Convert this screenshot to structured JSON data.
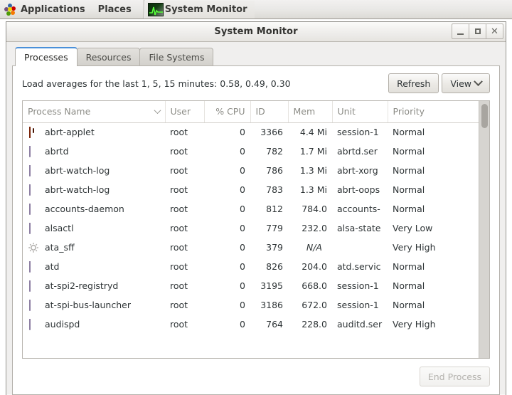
{
  "panel": {
    "applications_label": "Applications",
    "places_label": "Places",
    "apps_icon": "fedora-pinwheel-icon",
    "task": {
      "label": "System Monitor",
      "icon": "system-monitor-waveform-icon"
    }
  },
  "window": {
    "title": "System Monitor",
    "controls": {
      "minimize": "minimize-icon",
      "maximize": "maximize-icon",
      "close": "close-icon"
    }
  },
  "tabs": [
    {
      "label": "Processes",
      "active": true
    },
    {
      "label": "Resources",
      "active": false
    },
    {
      "label": "File Systems",
      "active": false
    }
  ],
  "toolbar": {
    "load_averages": "Load averages for the last 1, 5, 15 minutes: 0.58, 0.49, 0.30",
    "refresh_label": "Refresh",
    "view_label": "View"
  },
  "table": {
    "columns": [
      {
        "key": "name",
        "label": "Process Name",
        "align": "left",
        "sorted": true
      },
      {
        "key": "user",
        "label": "User",
        "align": "left"
      },
      {
        "key": "cpu",
        "label": "% CPU",
        "align": "right"
      },
      {
        "key": "id",
        "label": "ID",
        "align": "right"
      },
      {
        "key": "mem",
        "label": "Mem",
        "align": "right"
      },
      {
        "key": "unit",
        "label": "Unit",
        "align": "left"
      },
      {
        "key": "priority",
        "label": "Priority",
        "align": "left"
      }
    ],
    "rows": [
      {
        "icon": "abrt-applet-icon",
        "name": "abrt-applet",
        "user": "root",
        "cpu": "0",
        "id": "3366",
        "mem": "4.4 Mi",
        "unit": "session-1",
        "priority": "Normal"
      },
      {
        "icon": "binary-diamond-icon",
        "name": "abrtd",
        "user": "root",
        "cpu": "0",
        "id": "782",
        "mem": "1.7 Mi",
        "unit": "abrtd.ser",
        "priority": "Normal"
      },
      {
        "icon": "binary-diamond-icon",
        "name": "abrt-watch-log",
        "user": "root",
        "cpu": "0",
        "id": "786",
        "mem": "1.3 Mi",
        "unit": "abrt-xorg",
        "priority": "Normal"
      },
      {
        "icon": "binary-diamond-icon",
        "name": "abrt-watch-log",
        "user": "root",
        "cpu": "0",
        "id": "783",
        "mem": "1.3 Mi",
        "unit": "abrt-oops",
        "priority": "Normal"
      },
      {
        "icon": "binary-diamond-icon",
        "name": "accounts-daemon",
        "user": "root",
        "cpu": "0",
        "id": "812",
        "mem": "784.0",
        "unit": "accounts-",
        "priority": "Normal"
      },
      {
        "icon": "binary-diamond-icon",
        "name": "alsactl",
        "user": "root",
        "cpu": "0",
        "id": "779",
        "mem": "232.0",
        "unit": "alsa-state",
        "priority": "Very Low"
      },
      {
        "icon": "kernel-gear-icon",
        "name": "ata_sff",
        "user": "root",
        "cpu": "0",
        "id": "379",
        "mem": "N/A",
        "mem_na": true,
        "unit": "",
        "priority": "Very High"
      },
      {
        "icon": "binary-diamond-icon",
        "name": "atd",
        "user": "root",
        "cpu": "0",
        "id": "826",
        "mem": "204.0",
        "unit": "atd.servic",
        "priority": "Normal"
      },
      {
        "icon": "binary-diamond-icon",
        "name": "at-spi2-registryd",
        "user": "root",
        "cpu": "0",
        "id": "3195",
        "mem": "668.0",
        "unit": "session-1",
        "priority": "Normal"
      },
      {
        "icon": "binary-diamond-icon",
        "name": "at-spi-bus-launcher",
        "user": "root",
        "cpu": "0",
        "id": "3186",
        "mem": "672.0",
        "unit": "session-1",
        "priority": "Normal"
      },
      {
        "icon": "binary-diamond-icon",
        "name": "audispd",
        "user": "root",
        "cpu": "0",
        "id": "764",
        "mem": "228.0",
        "unit": "auditd.ser",
        "priority": "Very High"
      }
    ]
  },
  "actions": {
    "end_process_label": "End Process",
    "end_process_enabled": false
  },
  "colors": {
    "tab_accent": "#4a90d9",
    "panel_bg": "#e8e7e5",
    "window_bg": "#f0efee"
  }
}
